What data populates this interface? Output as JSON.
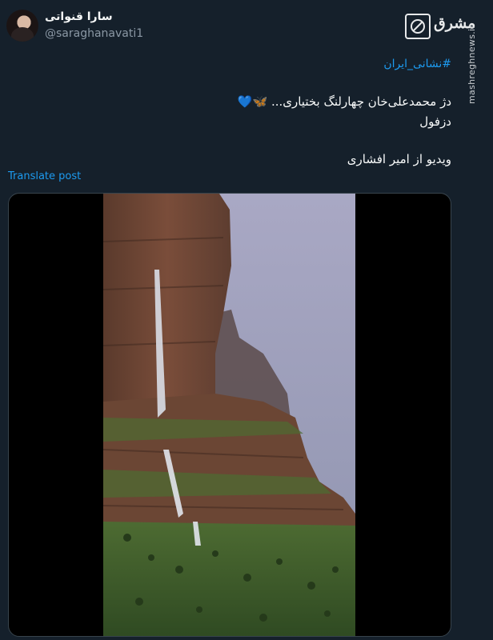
{
  "author": {
    "display_name": "سارا قنواتی",
    "handle": "@saraghanavati1"
  },
  "brand": {
    "logo_text": "مشرق",
    "side_watermark": "mashreghnews.ir"
  },
  "post": {
    "hashtag": "#نشانی_ایران",
    "line1_text": "دژ محمدعلی‌خان چهارلنگ بختیاری...",
    "line1_emojis": "🦋💙",
    "line2": "دزفول",
    "line3": "ویدیو از امیر افشاری",
    "translate_label": "Translate post"
  },
  "media": {
    "type": "video",
    "description_icon": "video-frame"
  },
  "colors": {
    "background": "#15202b",
    "link": "#1d9bf0",
    "text": "#f7f9f9",
    "secondary": "#8b98a5"
  }
}
